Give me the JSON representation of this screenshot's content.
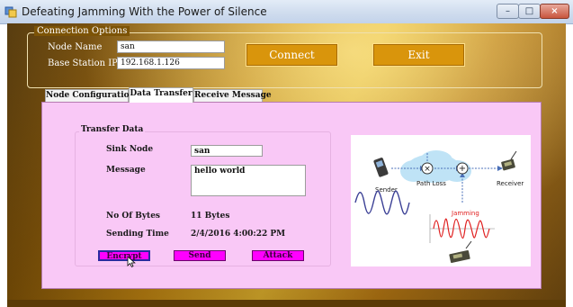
{
  "window": {
    "title": "Defeating Jamming With the Power of Silence",
    "controls": {
      "minimize": "–",
      "maximize": "□",
      "close": "×"
    }
  },
  "connection": {
    "group_label": "Connection Options",
    "node_name_label": "Node Name",
    "node_name_value": "san",
    "base_station_label": "Base Station IP",
    "base_station_value": "192.168.1.126",
    "connect_label": "Connect",
    "exit_label": "Exit"
  },
  "tabs": [
    {
      "label": "Node Configuration",
      "active": false
    },
    {
      "label": "Data Transfer",
      "active": true
    },
    {
      "label": "Receive Message",
      "active": false
    }
  ],
  "transfer": {
    "group_label": "Transfer Data",
    "sink_label": "Sink Node",
    "sink_value": "san",
    "message_label": "Message",
    "message_value": "hello world",
    "bytes_label": "No Of Bytes",
    "bytes_value": "11 Bytes",
    "time_label": "Sending Time",
    "time_value": "2/4/2016 4:00:22 PM",
    "encrypt_label": "Encrypt",
    "send_label": "Send",
    "attack_label": "Attack"
  },
  "diagram": {
    "sender_label": "Sender",
    "path_loss_label": "Path Loss",
    "receiver_label": "Receiver",
    "jamming_label": "Jamming",
    "multiply_symbol": "×",
    "plus_symbol": "+"
  },
  "colors": {
    "tab_page_bg": "#f9c8f6",
    "action_button": "#ff00ff",
    "header_button": "#d9950c",
    "jamming_text": "#e02020"
  }
}
